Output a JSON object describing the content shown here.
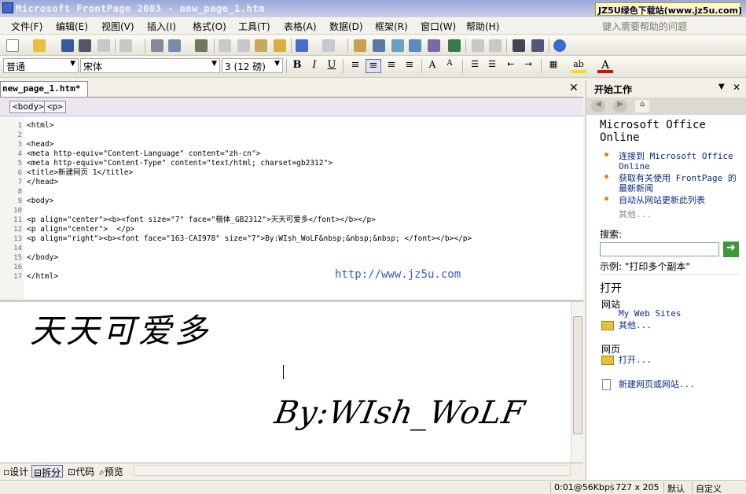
{
  "window": {
    "title": "Microsoft FrontPage 2003 - new_page_1.htm",
    "brand_badge": "JZ5U绿色下载站(www.jz5u.com)"
  },
  "menubar": {
    "items": [
      "文件(F)",
      "编辑(E)",
      "视图(V)",
      "插入(I)",
      "格式(O)",
      "工具(T)",
      "表格(A)",
      "数据(D)",
      "框架(R)",
      "窗口(W)",
      "帮助(H)"
    ],
    "help_placeholder": "键入需要帮助的问题"
  },
  "formatting": {
    "style": "普通",
    "font": "宋体",
    "size": "3 (12 磅)"
  },
  "document": {
    "tab_label": "new_page_1.htm*",
    "quick_tags": [
      "<body>",
      "<p>"
    ]
  },
  "code_lines": [
    {
      "n": "1",
      "t": "<html>"
    },
    {
      "n": "2",
      "t": ""
    },
    {
      "n": "3",
      "t": "<head>"
    },
    {
      "n": "4",
      "t": "<meta http-equiv=\"Content-Language\" content=\"zh-cn\">"
    },
    {
      "n": "5",
      "t": "<meta http-equiv=\"Content-Type\" content=\"text/html; charset=gb2312\">"
    },
    {
      "n": "6",
      "t": "<title>新建网页 1</title>"
    },
    {
      "n": "7",
      "t": "</head>"
    },
    {
      "n": "8",
      "t": ""
    },
    {
      "n": "9",
      "t": "<body>"
    },
    {
      "n": "10",
      "t": ""
    },
    {
      "n": "11",
      "t": "<p align=\"center\"><b><font size=\"7\" face=\"楷体_GB2312\">天天可爱多</font></b></p>"
    },
    {
      "n": "12",
      "t": "<p align=\"center\">  </p>"
    },
    {
      "n": "13",
      "t": "<p align=\"right\"><b><font face=\"163-CAI978\" size=\"7\">By:WIsh_WoLF&nbsp;&nbsp;&nbsp; </font></b></p>"
    },
    {
      "n": "14",
      "t": ""
    },
    {
      "n": "15",
      "t": "</body>"
    },
    {
      "n": "16",
      "t": ""
    },
    {
      "n": "17",
      "t": "</html>"
    }
  ],
  "watermark": "http://www.jz5u.com",
  "design": {
    "heading": "天天可爱多",
    "signature": "By:WIsh_WoLF"
  },
  "view_tabs": [
    "设计",
    "拆分",
    "代码",
    "预览"
  ],
  "active_view": "拆分",
  "status": {
    "download": "0:01@56Kbps",
    "dimensions": "727 x 205",
    "mode": "默认",
    "custom": "自定义"
  },
  "taskpane": {
    "title": "开始工作",
    "office_heading": "Microsoft Office Online",
    "links": [
      "连接到 Microsoft Office Online",
      "获取有关使用 FrontPage 的最新新闻",
      "自动从网站更新此列表"
    ],
    "more": "其他...",
    "search_label": "搜索:",
    "search_example": "示例:  \"打印多个副本\"",
    "open_heading": "打开",
    "site_label": "网站",
    "site_link": "My Web Sites",
    "site_more": "其他...",
    "page_label": "网页",
    "page_open": "打开...",
    "new_link": "新建网页或网站..."
  }
}
